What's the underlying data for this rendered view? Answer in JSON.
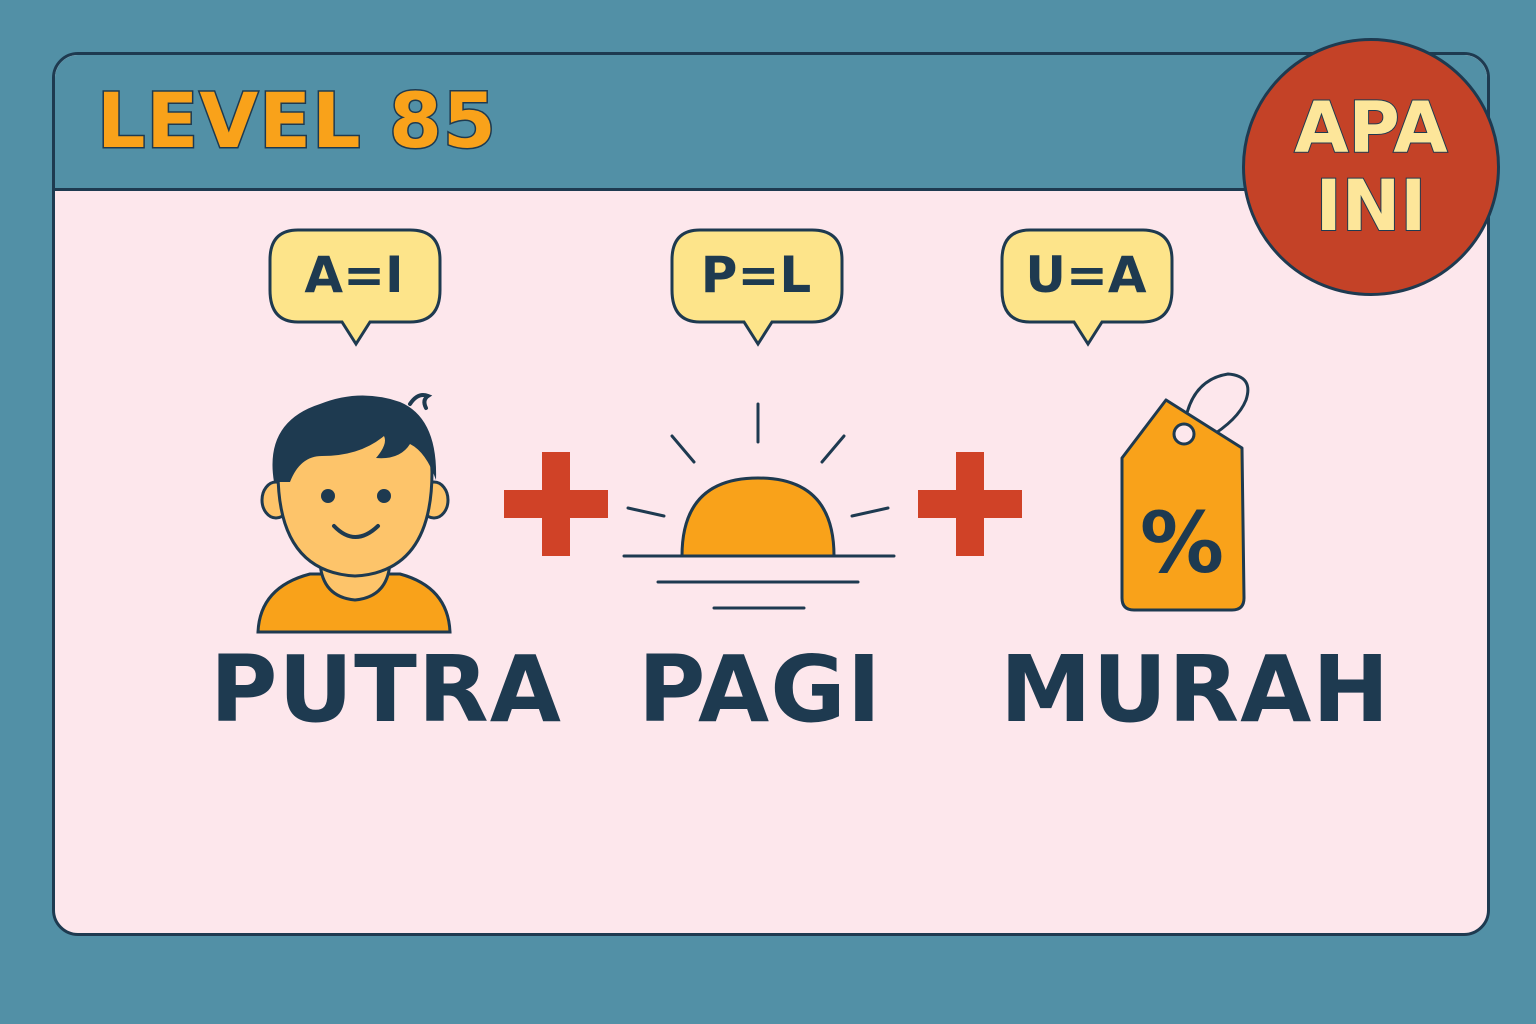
{
  "header": {
    "level_title": "LEVEL 85"
  },
  "badge": {
    "line1": "APA",
    "line2": "INI"
  },
  "clues": [
    {
      "hint": "A=I",
      "word": "PUTRA",
      "icon": "boy-icon"
    },
    {
      "hint": "P=L",
      "word": "PAGI",
      "icon": "sunrise-icon"
    },
    {
      "hint": "U=A",
      "word": "MURAH",
      "icon": "price-tag-icon"
    }
  ],
  "operators": [
    "+",
    "+"
  ],
  "colors": {
    "background": "#5290a6",
    "card": "#fde7ec",
    "outline": "#1e3a50",
    "title_orange": "#f9a21a",
    "badge_red": "#c44227",
    "bubble_yellow": "#fde48a",
    "plus_red": "#d04227",
    "icon_orange": "#f9a21a"
  }
}
